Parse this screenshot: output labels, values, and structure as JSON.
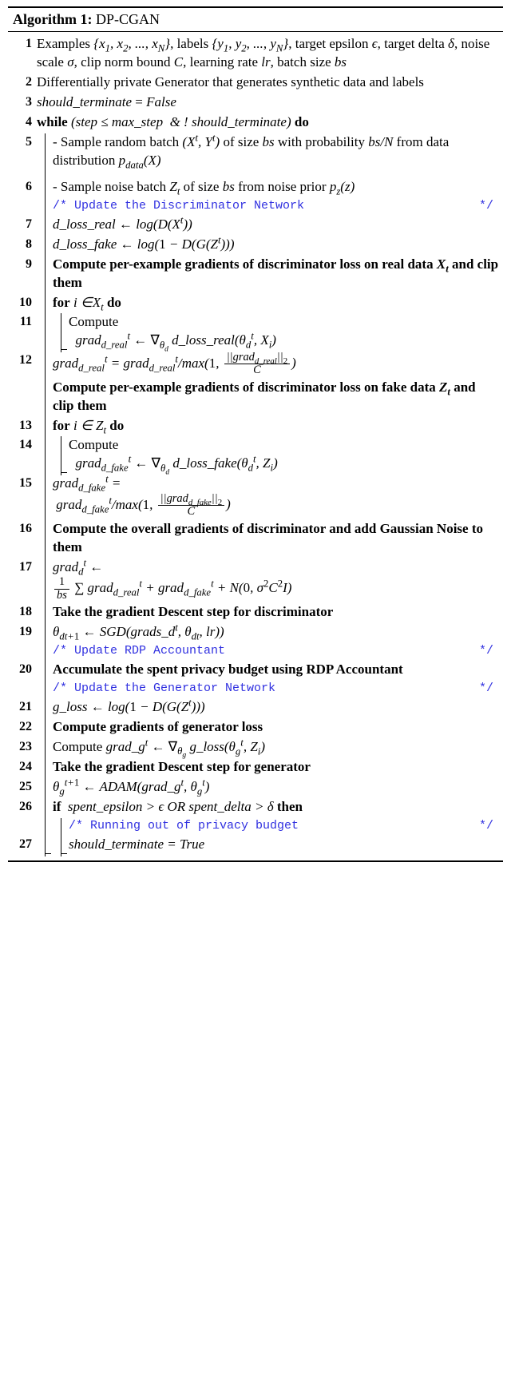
{
  "title_label": "Algorithm 1:",
  "title_name": "DP-CGAN",
  "lines": {
    "l1": "Examples {x₁, x₂, ..., x_N}, labels {y₁, y₂, ..., y_N}, target epsilon ϵ, target delta δ, noise scale σ, clip norm bound C, learning rate lr, batch size bs",
    "l2": "Differentially private Generator that generates synthetic data and labels",
    "l3": "should_terminate = False",
    "l4_pre": "while",
    "l4_cond": "(step ≤ max_step  & ! should_terminate)",
    "l4_post": "do",
    "l5": "- Sample random batch (Xᵗ, Yᵗ) of size bs with probability bs/N from data distribution p_data(X)",
    "l6": "- Sample noise batch Z_t of size bs from noise prior p_z(z)",
    "c1": "/* Update the Discriminator Network",
    "c1e": "*/",
    "l7": "d_loss_real ← log(D(Xᵗ))",
    "l8": "d_loss_fake ← log(1 − D(G(Zᵗ)))",
    "l9": "Compute per-example gradients of discriminator loss on real data X_t and clip them",
    "l10_pre": "for",
    "l10_cond": "i ∈ X_t",
    "l10_post": "do",
    "l11a": "Compute",
    "l11b": "grad_{d_real}ᵗ ← ∇_{θ_d} d_loss_real(θ_dᵗ, X_i)",
    "l12": "grad_{d_real}ᵗ = grad_{d_real}ᵗ / max(1, ||grad_{d_real}||₂ / C)",
    "l12b": "Compute per-example gradients of discriminator loss on fake data Z_t and clip them",
    "l13_pre": "for",
    "l13_cond": "i ∈ Z_t",
    "l13_post": "do",
    "l14a": "Compute",
    "l14b": "grad_{d_fake}ᵗ ← ∇_{θ_d} d_loss_fake(θ_dᵗ, Z_i)",
    "l15": "grad_{d_fake}ᵗ = grad_{d_fake}ᵗ / max(1, ||grad_{d_fake}||₂ / C)",
    "l16": "Compute the overall gradients of discriminator and add Gaussian Noise to them",
    "l17": "grad_dᵗ ← (1/bs) Σ grad_{d_real}ᵗ + grad_{d_fake}ᵗ + N(0, σ²C²I)",
    "l18": "Take the gradient Descent step for discriminator",
    "l19": "θ_{dt+1} ← SGD(grads_dᵗ, θ_{dt}, lr))",
    "c2": "/* Update RDP Accountant",
    "c2e": "*/",
    "l20": "Accumulate the spent privacy budget using RDP Accountant",
    "c3": "/* Update the Generator Network",
    "c3e": "*/",
    "l21": "g_loss ← log(1 − D(G(Zᵗ)))",
    "l22": "Compute gradients of generator loss",
    "l23": "Compute grad_gᵗ ← ∇_{θ_g} g_loss(θ_gᵗ, Z_i)",
    "l24": "Take the gradient Descent step for generator",
    "l25": "θ_gᵗ⁺¹ ← ADAM(grad_gᵗ, θ_gᵗ)",
    "l26_pre": "if",
    "l26_cond": "spent_epsilon > ϵ OR spent_delta > δ",
    "l26_post": "then",
    "c4": "/* Running out of privacy budget",
    "c4e": "*/",
    "l27": "should_terminate = True"
  }
}
